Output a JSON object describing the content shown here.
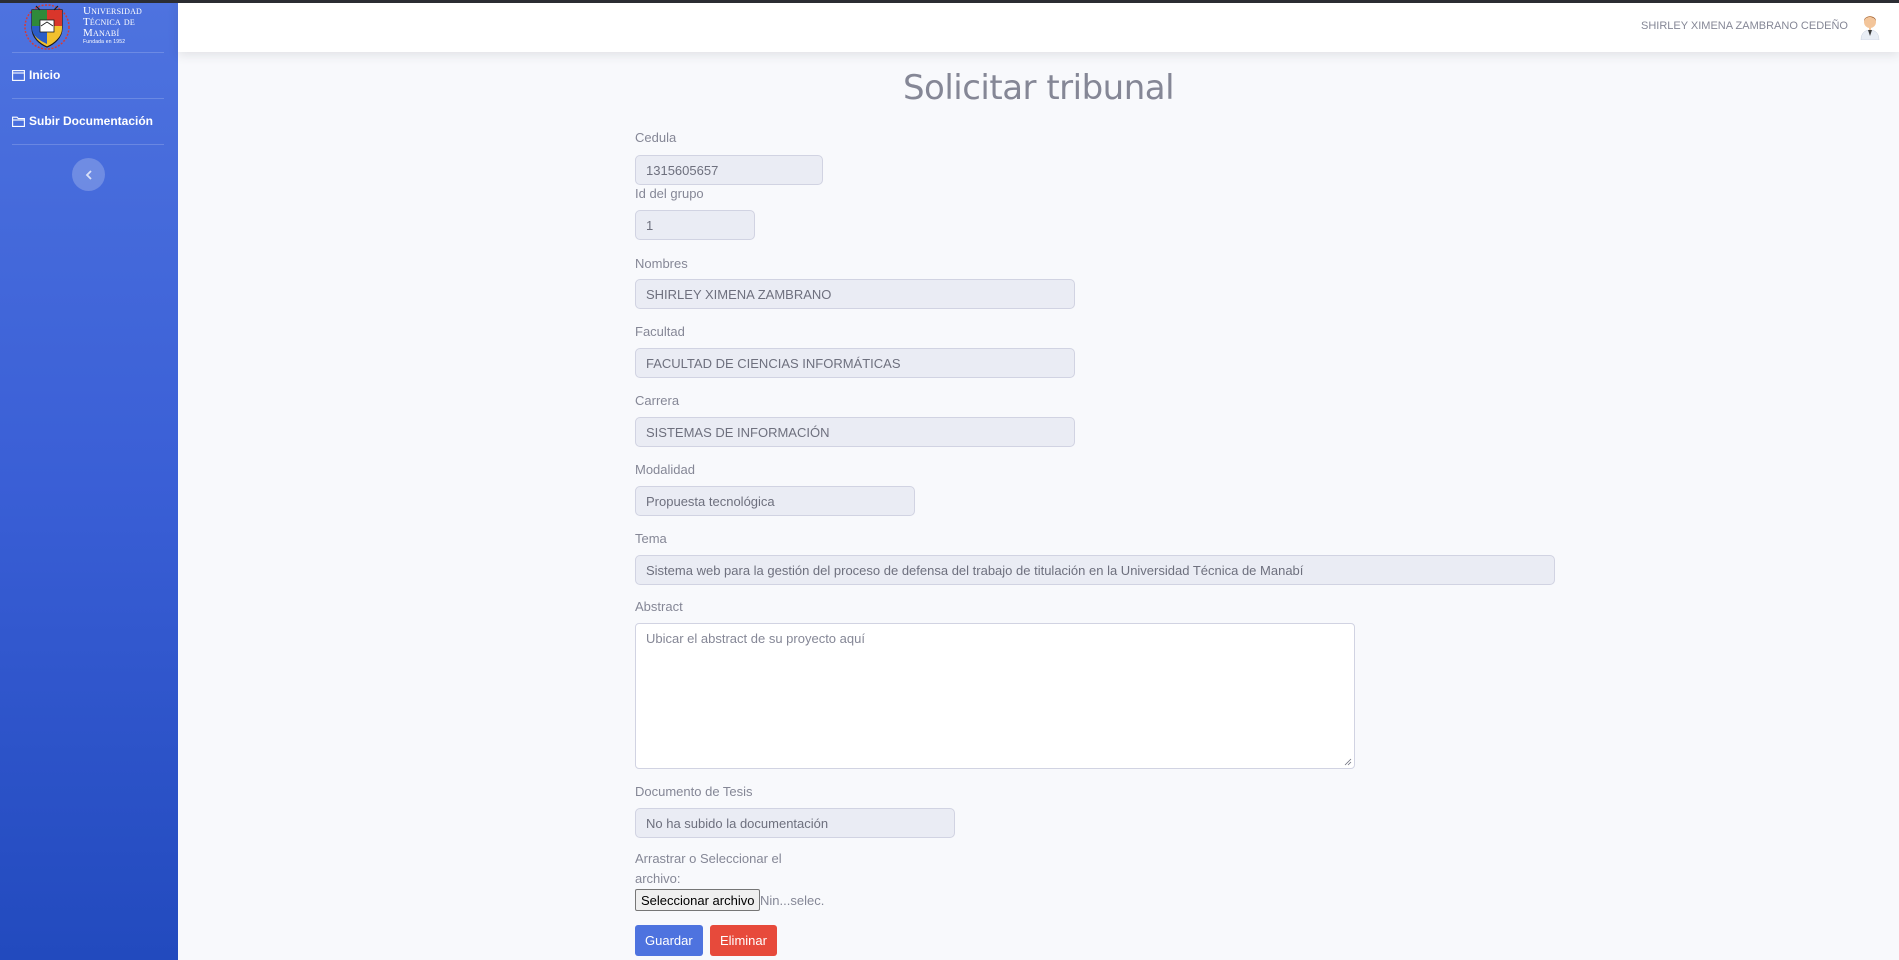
{
  "brand": {
    "line1": "Universidad",
    "line2": "Técnica de",
    "line3": "Manabí",
    "tagline": "Fundada en 1952"
  },
  "sidebar": {
    "items": [
      {
        "label": "Inicio",
        "icon": "window-icon"
      },
      {
        "label": "Subir Documentación",
        "icon": "folder-icon"
      }
    ],
    "toggle_icon": "chevron-left-icon"
  },
  "topbar": {
    "user_name": "SHIRLEY XIMENA ZAMBRANO CEDEÑO",
    "avatar_icon": "user-avatar-icon"
  },
  "page": {
    "title": "Solicitar tribunal"
  },
  "form": {
    "cedula": {
      "label": "Cedula",
      "value": "1315605657"
    },
    "grupo": {
      "label": "Id del grupo",
      "value": "1"
    },
    "nombres": {
      "label": "Nombres",
      "value": "SHIRLEY XIMENA ZAMBRANO"
    },
    "facultad": {
      "label": "Facultad",
      "value": "FACULTAD DE CIENCIAS INFORMÁTICAS"
    },
    "carrera": {
      "label": "Carrera",
      "value": "SISTEMAS DE INFORMACIÓN"
    },
    "modalidad": {
      "label": "Modalidad",
      "value": "Propuesta tecnológica"
    },
    "tema": {
      "label": "Tema",
      "value": "Sistema web para la gestión del proceso de defensa del trabajo de titulación en la Universidad Técnica de Manabí"
    },
    "abstract": {
      "label": "Abstract",
      "placeholder": "Ubicar el abstract de su proyecto aquí"
    },
    "documento": {
      "label": "Documento de Tesis",
      "value": "No ha subido la documentación"
    },
    "archivo": {
      "label_line1": "Arrastrar o Seleccionar el",
      "label_line2": "archivo:",
      "button": "Seleccionar archivo",
      "status": "Nin...selec."
    },
    "save_label": "Guardar",
    "delete_label": "Eliminar"
  },
  "colors": {
    "primary": "#4e73df",
    "danger": "#e74a3b",
    "sidebar_bottom": "#224abe"
  }
}
